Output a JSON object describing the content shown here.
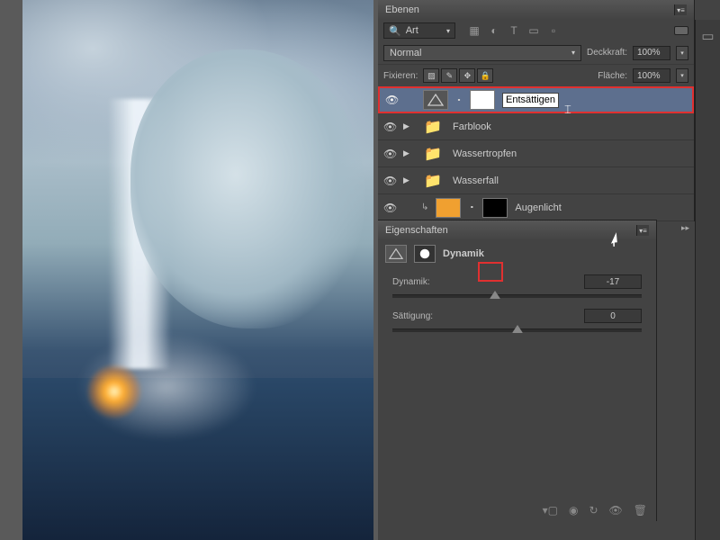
{
  "layers_panel": {
    "title": "Ebenen",
    "filter": {
      "icon": "🔍",
      "label": "Art",
      "type_icons": [
        "▢",
        "◕",
        "T",
        "▯",
        "▫"
      ]
    },
    "blend": {
      "mode": "Normal",
      "opacity_label": "Deckkraft:",
      "opacity": "100%"
    },
    "lock": {
      "label": "Fixieren:",
      "fill_label": "Fläche:",
      "fill": "100%"
    },
    "layers": [
      {
        "name_editing": "Entsättigen",
        "visible": true,
        "type": "adjustment",
        "selected": true
      },
      {
        "name": "Farblook",
        "visible": true,
        "type": "group"
      },
      {
        "name": "Wassertropfen",
        "visible": true,
        "type": "group"
      },
      {
        "name": "Wasserfall",
        "visible": true,
        "type": "group"
      },
      {
        "name": "Augenlicht",
        "visible": true,
        "type": "colorfill"
      }
    ]
  },
  "properties_panel": {
    "title": "Eigenschaften",
    "adjustment_name": "Dynamik",
    "sliders": [
      {
        "label": "Dynamik:",
        "value": "-17",
        "pos": 41
      },
      {
        "label": "Sättigung:",
        "value": "0",
        "pos": 50
      }
    ]
  }
}
